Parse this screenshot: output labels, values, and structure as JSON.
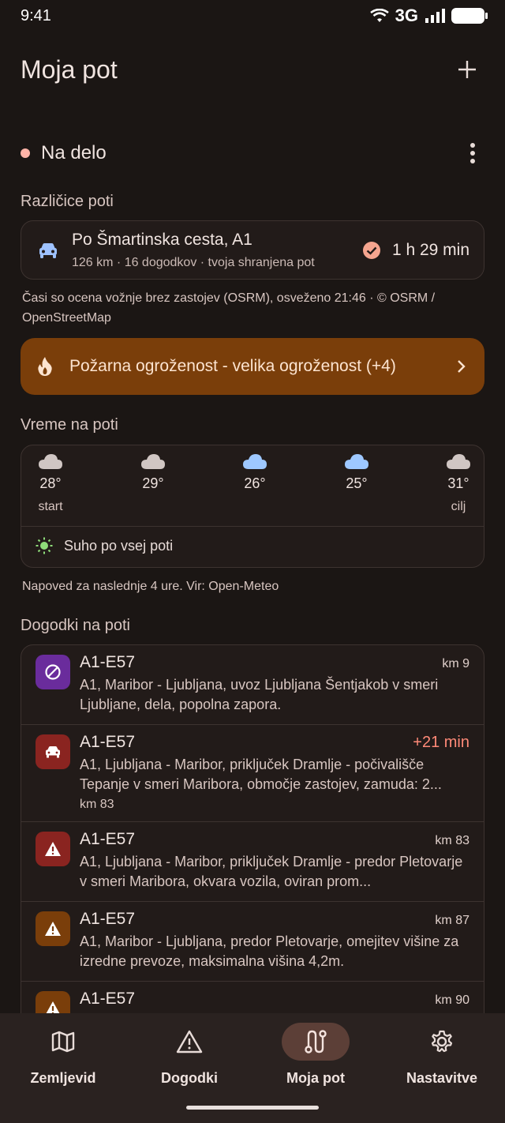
{
  "status": {
    "time": "9:41",
    "network": "3G"
  },
  "header": {
    "title": "Moja pot"
  },
  "route": {
    "name": "Na delo"
  },
  "variants": {
    "title": "Različice poti",
    "item": {
      "name": "Po Šmartinska cesta, A1",
      "details": "126 km · 16 dogodkov · tvoja shranjena pot",
      "time": "1 h 29 min"
    },
    "note": "Časi so ocena vožnje brez zastojev (OSRM), osveženo 21:46 · © OSRM / OpenStreetMap"
  },
  "fire": {
    "label": "Požarna ogroženost - velika ogroženost (+4)"
  },
  "weather": {
    "title": "Vreme na poti",
    "points": [
      {
        "temp": "28°",
        "label": "start",
        "icon": "cloud-icon"
      },
      {
        "temp": "29°",
        "label": "",
        "icon": "cloud-icon"
      },
      {
        "temp": "26°",
        "label": "",
        "icon": "rain-cloud-icon"
      },
      {
        "temp": "25°",
        "label": "",
        "icon": "rain-cloud-icon"
      },
      {
        "temp": "31°",
        "label": "cilj",
        "icon": "cloud-icon"
      }
    ],
    "summary": "Suho po vsej poti",
    "note": "Napoved za naslednje 4 ure. Vir: Open-Meteo"
  },
  "events": {
    "title": "Dogodki na poti",
    "items": [
      {
        "road": "A1-E57",
        "right": "km 9",
        "desc": "A1, Maribor - Ljubljana, uvoz Ljubljana Šentjakob v smeri Ljubljane, dela, popolna zapora.",
        "extra": "",
        "icon": "closure-icon",
        "color": "#6a2c9c"
      },
      {
        "road": "A1-E57",
        "right": "+21 min",
        "desc": "A1, Ljubljana - Maribor, priključek Dramlje - počivališče Tepanje v smeri Maribora, območje zastojev, zamuda: 2...",
        "extra": "km 83",
        "icon": "car-icon",
        "color": "#8a2420"
      },
      {
        "road": "A1-E57",
        "right": "km 83",
        "desc": "A1, Ljubljana - Maribor, priključek Dramlje - predor Pletovarje v smeri Maribora, okvara vozila, oviran prom...",
        "extra": "",
        "icon": "warning-icon",
        "color": "#8a2420"
      },
      {
        "road": "A1-E57",
        "right": "km 87",
        "desc": "A1, Maribor - Ljubljana, predor Pletovarje, omejitev višine za izredne prevoze, maksimalna višina 4,2m.",
        "extra": "",
        "icon": "warning-icon",
        "color": "#7a3e0a"
      },
      {
        "road": "A1-E57",
        "right": "km 90",
        "desc": "",
        "extra": "",
        "icon": "warning-icon",
        "color": "#7a3e0a"
      }
    ]
  },
  "nav": {
    "items": [
      {
        "label": "Zemljevid",
        "icon": "map-icon"
      },
      {
        "label": "Dogodki",
        "icon": "warning-icon"
      },
      {
        "label": "Moja pot",
        "icon": "route-icon"
      },
      {
        "label": "Nastavitve",
        "icon": "gear-icon"
      }
    ]
  },
  "colors": {
    "background": "#1b1614",
    "accent": "#ffb4a8",
    "fire": "#7a3e0a",
    "delay": "#ff8a78"
  }
}
